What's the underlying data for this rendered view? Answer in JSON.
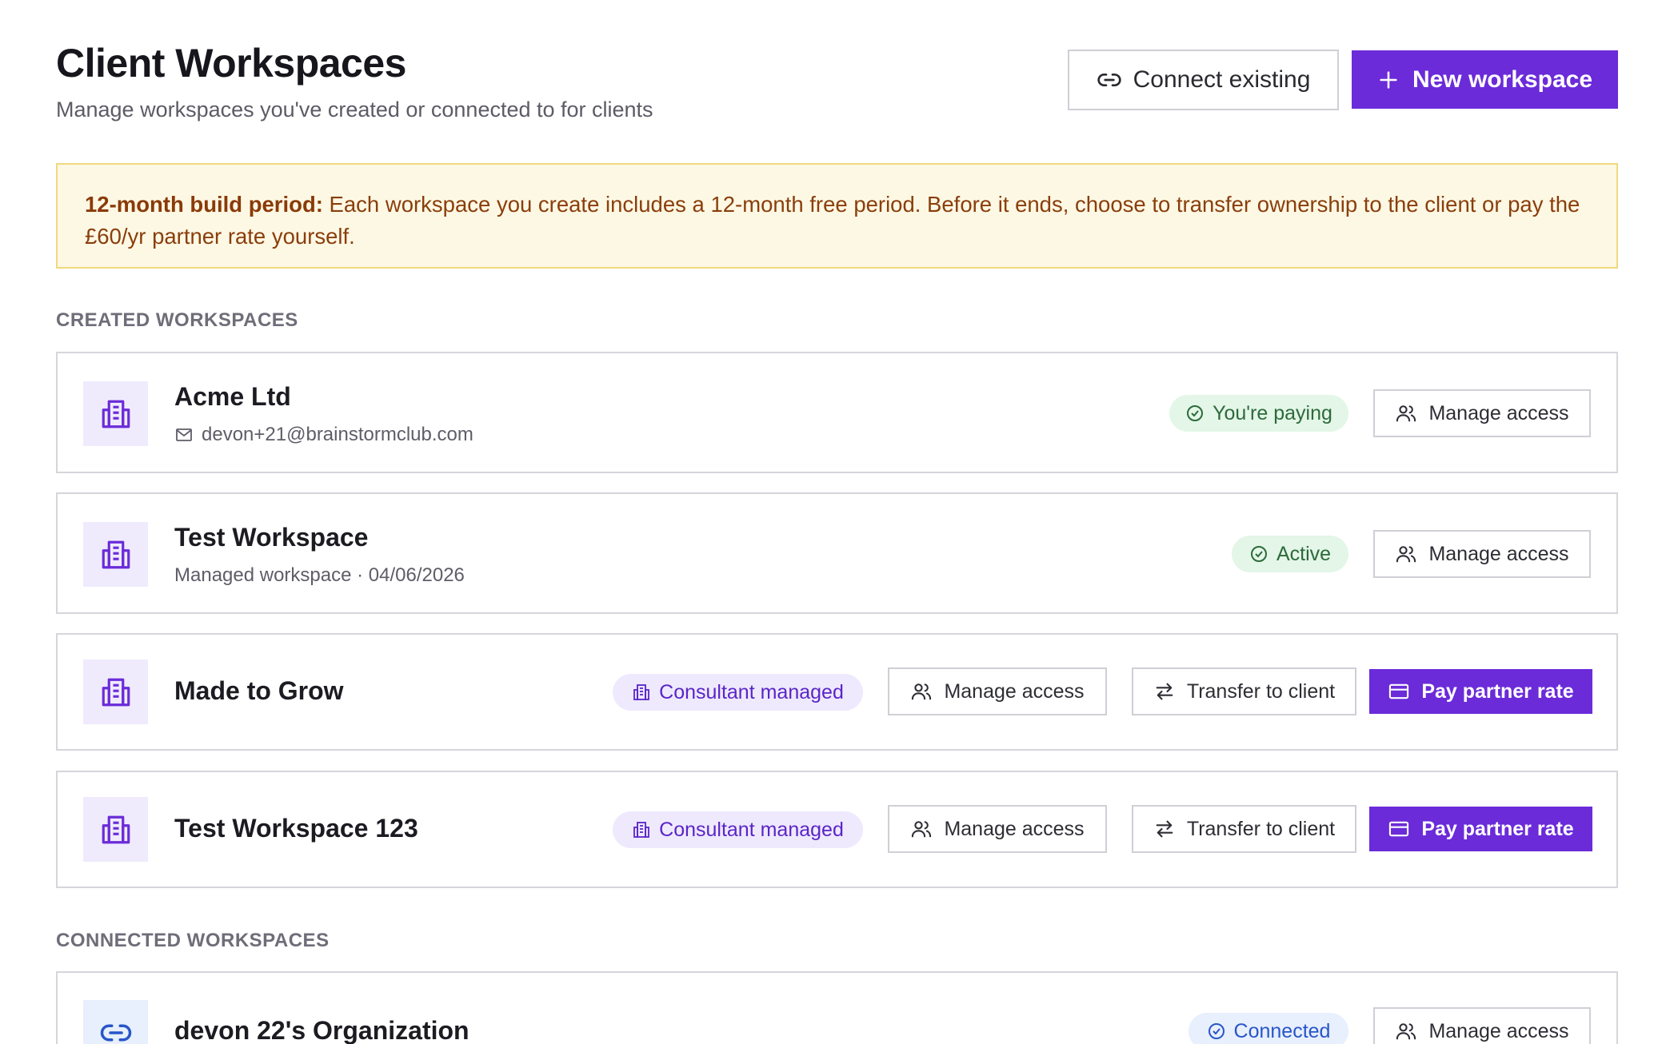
{
  "header": {
    "title": "Client Workspaces",
    "subtitle": "Manage workspaces you've created or connected to for clients",
    "connect_label": "Connect existing",
    "new_label": "New workspace"
  },
  "notice": {
    "bold": "12-month build period:",
    "text": " Each workspace you create includes a 12-month free period. Before it ends, choose to transfer ownership to the client or pay the £60/yr partner rate yourself."
  },
  "sections": {
    "created": "CREATED WORKSPACES",
    "connected": "CONNECTED WORKSPACES"
  },
  "labels": {
    "manage_access": "Manage access",
    "transfer": "Transfer to client",
    "pay": "Pay partner rate"
  },
  "created": [
    {
      "name": "Acme Ltd",
      "meta": "devon+21@brainstormclub.com",
      "status": "You're paying"
    },
    {
      "name": "Test Workspace",
      "meta": "Managed workspace · 04/06/2026",
      "status": "Active"
    },
    {
      "name": "Made to Grow",
      "status": "Consultant managed"
    },
    {
      "name": "Test Workspace 123",
      "status": "Consultant managed"
    }
  ],
  "connected": [
    {
      "name": "devon 22's Organization",
      "status": "Connected"
    }
  ],
  "colors": {
    "accent": "#6b2bd9",
    "notice_bg": "#fdf8e4",
    "success_bg": "#e3f6e8",
    "info_bg": "#e8effd"
  }
}
